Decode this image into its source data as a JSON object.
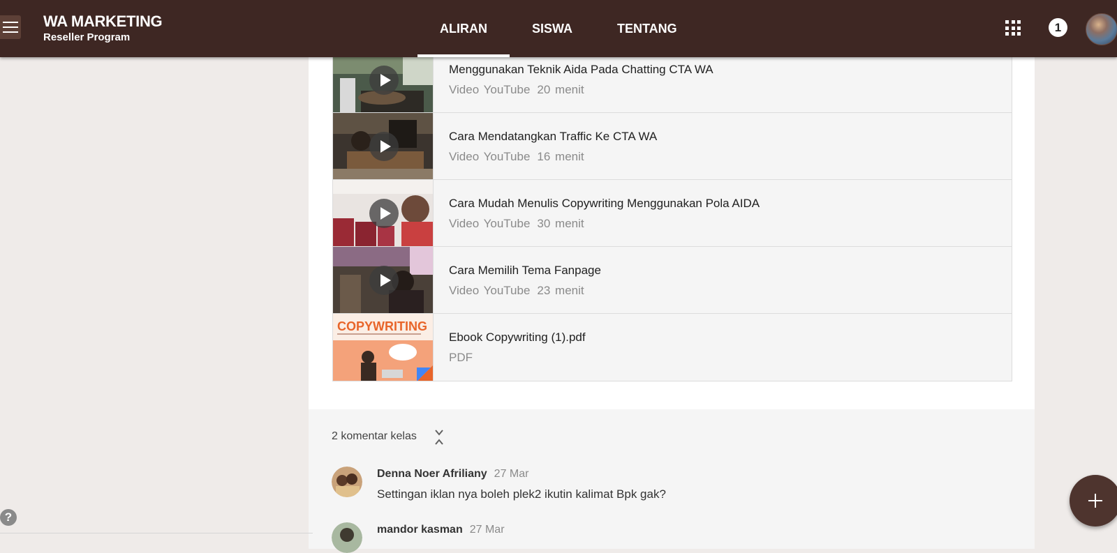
{
  "header": {
    "class_name": "WA MARKETING",
    "class_section": "Reseller Program",
    "tabs": [
      {
        "label": "ALIRAN",
        "active": true
      },
      {
        "label": "SISWA",
        "active": false
      },
      {
        "label": "TENTANG",
        "active": false
      }
    ],
    "notification_count": "1",
    "background_color": "#3e2723"
  },
  "attachments": [
    {
      "title": "Menggunakan Teknik Aida Pada Chatting CTA WA",
      "type": "Video YouTube",
      "duration": "20 menit",
      "icon": "play-icon"
    },
    {
      "title": "Cara Mendatangkan Traffic Ke CTA WA",
      "type": "Video YouTube",
      "duration": "16 menit",
      "icon": "play-icon"
    },
    {
      "title": "Cara Mudah Menulis Copywriting Menggunakan Pola AIDA",
      "type": "Video YouTube",
      "duration": "30 menit",
      "icon": "play-icon"
    },
    {
      "title": "Cara Memilih Tema Fanpage",
      "type": "Video YouTube",
      "duration": "23 menit",
      "icon": "play-icon"
    },
    {
      "title": "Ebook Copywriting (1).pdf",
      "type": "PDF",
      "duration": "",
      "thumb_text": "COPYWRITING"
    }
  ],
  "comments": {
    "toggle_label": "2 komentar kelas",
    "items": [
      {
        "author": "Denna Noer Afriliany",
        "date": "27 Mar",
        "text": "Settingan iklan nya boleh plek2 ikutin kalimat Bpk gak?"
      },
      {
        "author": "mandor kasman",
        "date": "27 Mar",
        "text": ""
      }
    ]
  },
  "help_label": "?"
}
